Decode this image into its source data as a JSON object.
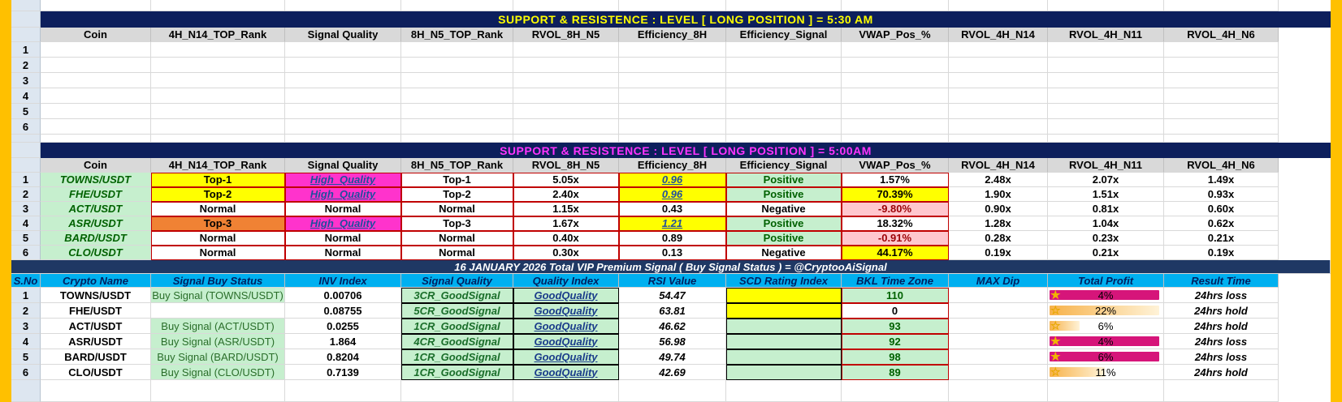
{
  "columns": [
    "Coin",
    "4H_N14_TOP_Rank",
    "Signal Quality",
    "8H_N5_TOP_Rank",
    "RVOL_8H_N5",
    "Efficiency_8H",
    "Efficiency_Signal",
    "VWAP_Pos_%",
    "RVOL_4H_N14",
    "RVOL_4H_N11",
    "RVOL_4H_N6"
  ],
  "banner1": "SUPPORT  &  RESISTENCE  :  LEVEL    [   LONG   POSITION   ]       =       5:30 AM",
  "banner2": "SUPPORT  &  RESISTENCE  :  LEVEL    [   LONG   POSITION   ]       =       5:00AM",
  "empty_rows": [
    "1",
    "2",
    "3",
    "4",
    "5",
    "6"
  ],
  "table2": [
    {
      "n": "1",
      "coin": "TOWNS/USDT",
      "r14": "Top-1",
      "sq": "High_Quality",
      "r5": "Top-1",
      "rv": "5.05x",
      "eff": "0.96",
      "es": "Positive",
      "vwap": "1.57%",
      "a": "2.48x",
      "b": "2.07x",
      "c": "1.49x"
    },
    {
      "n": "2",
      "coin": "FHE/USDT",
      "r14": "Top-2",
      "sq": "High_Quality",
      "r5": "Top-2",
      "rv": "2.40x",
      "eff": "0.96",
      "es": "Positive",
      "vwap": "70.39%",
      "a": "1.90x",
      "b": "1.51x",
      "c": "0.93x"
    },
    {
      "n": "3",
      "coin": "ACT/USDT",
      "r14": "Normal",
      "sq": "Normal",
      "r5": "Normal",
      "rv": "1.15x",
      "eff": "0.43",
      "es": "Negative",
      "vwap": "-9.80%",
      "a": "0.90x",
      "b": "0.81x",
      "c": "0.60x"
    },
    {
      "n": "4",
      "coin": "ASR/USDT",
      "r14": "Top-3",
      "sq": "High_Quality",
      "r5": "Top-3",
      "rv": "1.67x",
      "eff": "1.21",
      "es": "Positive",
      "vwap": "18.32%",
      "a": "1.28x",
      "b": "1.04x",
      "c": "0.62x"
    },
    {
      "n": "5",
      "coin": "BARD/USDT",
      "r14": "Normal",
      "sq": "Normal",
      "r5": "Normal",
      "rv": "0.40x",
      "eff": "0.89",
      "es": "Positive",
      "vwap": "-0.91%",
      "a": "0.28x",
      "b": "0.23x",
      "c": "0.21x"
    },
    {
      "n": "6",
      "coin": "CLO/USDT",
      "r14": "Normal",
      "sq": "Normal",
      "r5": "Normal",
      "rv": "0.30x",
      "eff": "0.13",
      "es": "Negative",
      "vwap": "44.17%",
      "a": "0.19x",
      "b": "0.21x",
      "c": "0.19x"
    }
  ],
  "banner3": "16   JANUARY   2026    Total VIP Premium Signal   ( Buy Signal Status )    =   @CryptooAiSignal",
  "columns3": [
    "S.No",
    "Crypto Name",
    "Signal Buy Status",
    "INV  Index",
    "Signal Quality",
    "Quality Index",
    "RSI Value",
    "SCD  Rating Index",
    "BKL Time Zone",
    "MAX Dip",
    "Total Profit",
    "Result Time"
  ],
  "table3": [
    {
      "n": "1",
      "name": "TOWNS/USDT",
      "status": "Buy Signal (TOWNS/USDT)",
      "inv": "0.00706",
      "sq": "3CR_GoodSignal",
      "qi": "GoodQuality",
      "rsi": "54.47",
      "bkl": "110",
      "profit": "4%",
      "pct": 4,
      "result": "24hrs loss"
    },
    {
      "n": "2",
      "name": "FHE/USDT",
      "status": "",
      "inv": "0.08755",
      "sq": "5CR_GoodSignal",
      "qi": "GoodQuality",
      "rsi": "63.81",
      "bkl": "0",
      "profit": "22%",
      "pct": 22,
      "result": "24hrs hold"
    },
    {
      "n": "3",
      "name": "ACT/USDT",
      "status": "Buy Signal (ACT/USDT)",
      "inv": "0.0255",
      "sq": "1CR_GoodSignal",
      "qi": "GoodQuality",
      "rsi": "46.62",
      "bkl": "93",
      "profit": "6%",
      "pct": 6,
      "result": "24hrs hold"
    },
    {
      "n": "4",
      "name": "ASR/USDT",
      "status": "Buy Signal (ASR/USDT)",
      "inv": "1.864",
      "sq": "4CR_GoodSignal",
      "qi": "GoodQuality",
      "rsi": "56.98",
      "bkl": "92",
      "profit": "4%",
      "pct": 4,
      "result": "24hrs loss"
    },
    {
      "n": "5",
      "name": "BARD/USDT",
      "status": "Buy Signal (BARD/USDT)",
      "inv": "0.8204",
      "sq": "1CR_GoodSignal",
      "qi": "GoodQuality",
      "rsi": "49.74",
      "bkl": "98",
      "profit": "6%",
      "pct": 6,
      "result": "24hrs loss"
    },
    {
      "n": "6",
      "name": "CLO/USDT",
      "status": "Buy Signal (CLO/USDT)",
      "inv": "0.7139",
      "sq": "1CR_GoodSignal",
      "qi": "GoodQuality",
      "rsi": "42.69",
      "bkl": "89",
      "profit": "11%",
      "pct": 11,
      "result": "24hrs hold"
    }
  ]
}
